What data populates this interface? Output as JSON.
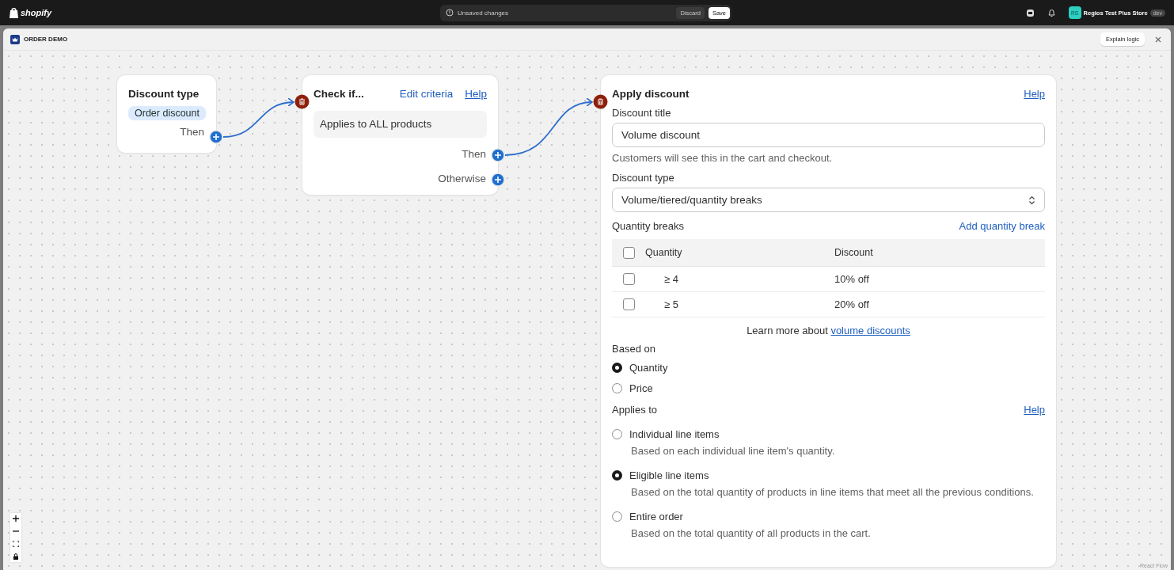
{
  "topbar": {
    "brand": "shopify",
    "notice": "Unsaved changes",
    "discard": "Discard",
    "save": "Save",
    "store_initials": "RS",
    "store_name": "Regios Test Plus Store",
    "store_badge": "dev"
  },
  "window": {
    "title": "ORDER DEMO",
    "explain_button": "Explain logic"
  },
  "discount_type_node": {
    "title": "Discount type",
    "tag": "Order discount",
    "outputs": [
      "Then"
    ]
  },
  "check_node": {
    "title": "Check if...",
    "edit_link": "Edit criteria",
    "help_link": "Help",
    "criteria": "Applies to ALL products",
    "outputs": [
      "Then",
      "Otherwise"
    ]
  },
  "apply_node": {
    "title": "Apply discount",
    "help_link": "Help",
    "title_field": {
      "label": "Discount title",
      "value": "Volume discount",
      "help": "Customers will see this in the cart and checkout."
    },
    "type_select": {
      "label": "Discount type",
      "value": "Volume/tiered/quantity breaks"
    },
    "breaks": {
      "label": "Quantity breaks",
      "add_link": "Add quantity break",
      "columns": [
        "Quantity",
        "Discount"
      ],
      "select_all_checked": false,
      "rows": [
        {
          "quantity": "≥ 4",
          "discount": "10% off",
          "checked": false
        },
        {
          "quantity": "≥ 5",
          "discount": "20% off",
          "checked": false
        }
      ]
    },
    "learn_more": {
      "text": "Learn more about",
      "link": "volume discounts"
    },
    "based_on": {
      "label": "Based on",
      "options": [
        {
          "label": "Quantity",
          "selected": true
        },
        {
          "label": "Price",
          "selected": false
        }
      ]
    },
    "applies_to": {
      "label": "Applies to",
      "help_link": "Help",
      "options": [
        {
          "label": "Individual line items",
          "help": "Based on each individual line item's quantity.",
          "selected": false
        },
        {
          "label": "Eligible line items",
          "help": "Based on the total quantity of products in line items that meet all the previous conditions.",
          "selected": true
        },
        {
          "label": "Entire order",
          "help": "Based on the total quantity of all products in the cart.",
          "selected": false
        }
      ]
    }
  },
  "attribution": "React Flow"
}
